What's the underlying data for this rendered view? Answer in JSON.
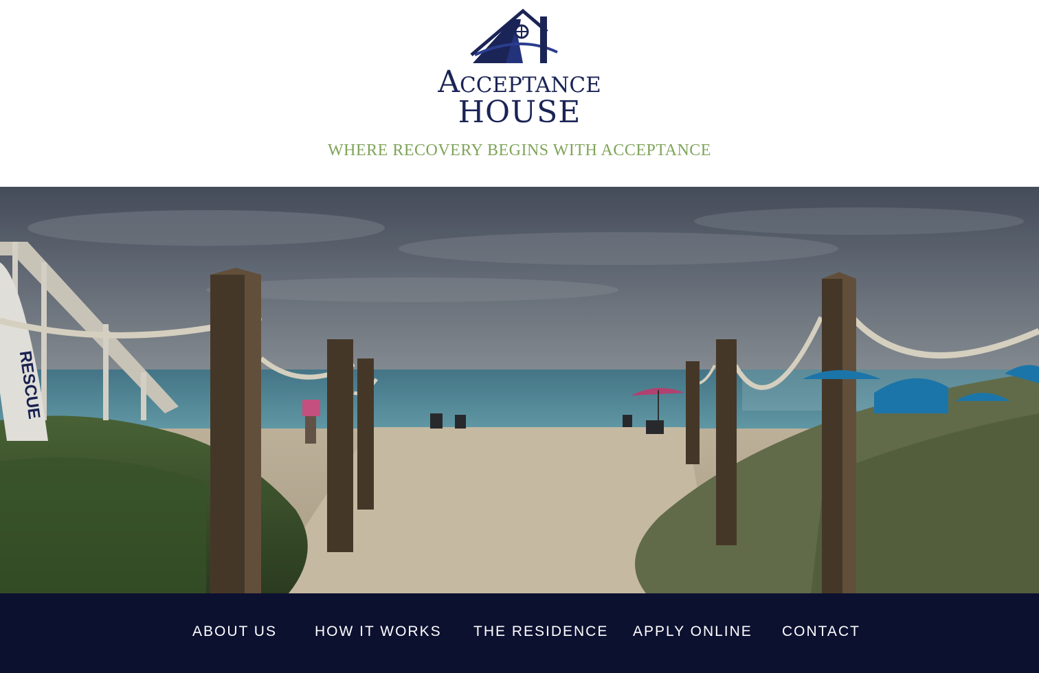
{
  "header": {
    "logo": {
      "line1": "Acceptance",
      "line2": "HOUSE"
    },
    "tagline": "WHERE RECOVERY BEGINS WITH ACCEPTANCE"
  },
  "hero": {
    "sign_text": "RESCUE"
  },
  "nav": {
    "items": [
      {
        "label": "ABOUT US"
      },
      {
        "label": "HOW IT WORKS"
      },
      {
        "label": "THE RESIDENCE"
      },
      {
        "label": "APPLY ONLINE"
      },
      {
        "label": "CONTACT"
      }
    ]
  },
  "colors": {
    "brand_navy": "#1b2456",
    "tagline_green": "#7fa45a",
    "nav_bg": "#0d1130"
  }
}
